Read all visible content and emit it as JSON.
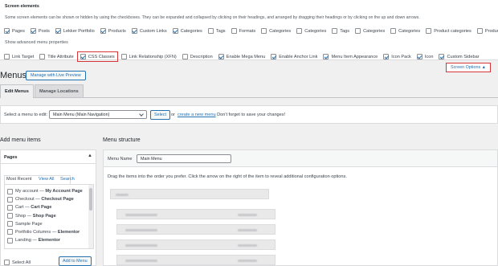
{
  "screen_options": {
    "title": "Screen elements",
    "description": "Some screen elements can be shown or hidden by using the checkboxes. They can be expanded and collapsed by clicking on their headings, and arranged by dragging their headings or by clicking on the up and down arrows.",
    "elements": [
      {
        "label": "Pages",
        "checked": true
      },
      {
        "label": "Posts",
        "checked": true
      },
      {
        "label": "Lekker Portfolio",
        "checked": true
      },
      {
        "label": "Products",
        "checked": true
      },
      {
        "label": "Custom Links",
        "checked": true
      },
      {
        "label": "Categories",
        "checked": true
      },
      {
        "label": "Tags",
        "checked": false
      },
      {
        "label": "Formats",
        "checked": false
      },
      {
        "label": "Categories",
        "checked": false
      },
      {
        "label": "Categories",
        "checked": false
      },
      {
        "label": "Tags",
        "checked": false
      },
      {
        "label": "Categories",
        "checked": false
      },
      {
        "label": "Categories",
        "checked": false
      },
      {
        "label": "Product categories",
        "checked": false
      },
      {
        "label": "Product tags",
        "checked": false
      }
    ],
    "advanced_title": "Show advanced menu properties",
    "advanced": [
      {
        "label": "Link Target",
        "checked": false
      },
      {
        "label": "Title Attribute",
        "checked": false
      },
      {
        "label": "CSS Classes",
        "checked": true
      },
      {
        "label": "Link Relationship (XFN)",
        "checked": false
      },
      {
        "label": "Description",
        "checked": false
      },
      {
        "label": "Enable Mega Menu",
        "checked": true
      },
      {
        "label": "Enable Anchor Link",
        "checked": true
      },
      {
        "label": "Menu Item Appearance",
        "checked": true
      },
      {
        "label": "Icon Pack",
        "checked": true
      },
      {
        "label": "Icon",
        "checked": true
      },
      {
        "label": "Custom Sidebar",
        "checked": true
      }
    ]
  },
  "header": {
    "title": "Menus",
    "live_preview_label": "Manage with Live Preview",
    "screen_options_label": "Screen Options ▲"
  },
  "tabs": [
    {
      "label": "Edit Menus",
      "active": true
    },
    {
      "label": "Manage Locations",
      "active": false
    }
  ],
  "select_menu": {
    "label": "Select a menu to edit:",
    "value": "Main Menu (Main Navigation)",
    "select_button": "Select",
    "or": "or",
    "create_link": "create a new menu",
    "after": ". Don't forget to save your changes!"
  },
  "add_items": {
    "title": "Add menu items",
    "pages_title": "Pages",
    "tabs": [
      "Most Recent",
      "View All",
      "Search"
    ],
    "pages": [
      {
        "prefix": "My account — ",
        "bold": "My Account Page"
      },
      {
        "prefix": "Checkout — ",
        "bold": "Checkout Page"
      },
      {
        "prefix": "Cart — ",
        "bold": "Cart Page"
      },
      {
        "prefix": "Shop — ",
        "bold": "Shop Page"
      },
      {
        "prefix": "Sample Page",
        "bold": ""
      },
      {
        "prefix": "Portfolio Columns — ",
        "bold": "Elementor"
      },
      {
        "prefix": "Landing — ",
        "bold": "Elementor"
      }
    ],
    "select_all": "Select All",
    "add_button": "Add to Menu"
  },
  "structure": {
    "title": "Menu structure",
    "name_label": "Menu Name",
    "name_value": "Main Menu",
    "instructions": "Drag the items into the order you prefer. Click the arrow on the right of the item to reveal additional configuration options."
  },
  "colors": {
    "accent": "#2271b1",
    "highlight": "#d63638"
  }
}
